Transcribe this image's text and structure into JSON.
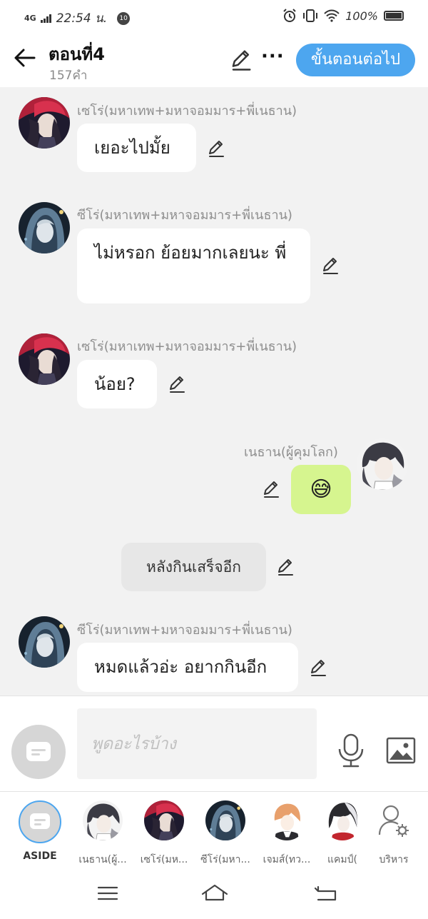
{
  "status_bar": {
    "network": "4G",
    "time": "22:54 น.",
    "notification_count": "10",
    "battery": "100%"
  },
  "header": {
    "title": "ตอนที่4",
    "subtitle": "157คำ",
    "next_button": "ขั้นตอนต่อไป"
  },
  "messages": [
    {
      "type": "left",
      "sender": "เซโร่(มหาเทพ+มหาจอมมาร+พี่เนธาน)",
      "text": "เยอะไปมั้ย",
      "avatar": "red-hair-avatar"
    },
    {
      "type": "left",
      "sender": "ซีโร่(มหาเทพ+มหาจอมมาร+พี่เนธาน)",
      "text": "ไม่หรอก ย้อยมากเลยนะ พี่",
      "avatar": "blue-hood-avatar"
    },
    {
      "type": "left",
      "sender": "เซโร่(มหาเทพ+มหาจอมมาร+พี่เนธาน)",
      "text": "น้อย?",
      "avatar": "red-hair-avatar"
    },
    {
      "type": "right",
      "sender": "เนธาน(ผู้คุมโลก)",
      "text": "😅",
      "avatar": "dark-hair-avatar"
    },
    {
      "type": "center",
      "text": "หลังกินเสร็จอีก"
    },
    {
      "type": "left",
      "sender": "ซีโร่(มหาเทพ+มหาจอมมาร+พี่เนธาน)",
      "text": "หมดแล้วอ่ะ อยากกินอีก",
      "avatar": "blue-hood-avatar"
    }
  ],
  "input": {
    "placeholder": "พูดอะไรบ้าง"
  },
  "characters": [
    {
      "label": "ASIDE",
      "icon": "aside-icon"
    },
    {
      "label": "เนธาน(ผู้...",
      "icon": "dark-hair-avatar"
    },
    {
      "label": "เซโร่(มห...",
      "icon": "red-hair-avatar"
    },
    {
      "label": "ซีโร่(มหา...",
      "icon": "blue-hood-avatar"
    },
    {
      "label": "เจมส์(ทว...",
      "icon": "orange-hair-avatar"
    },
    {
      "label": "แคมป์(",
      "icon": "black-white-hair-avatar"
    },
    {
      "label": "บริหาร",
      "icon": "manage-user-icon"
    }
  ],
  "colors": {
    "accent": "#4da6ef",
    "own_bubble": "#d6f58f",
    "background": "#f2f2f2"
  }
}
